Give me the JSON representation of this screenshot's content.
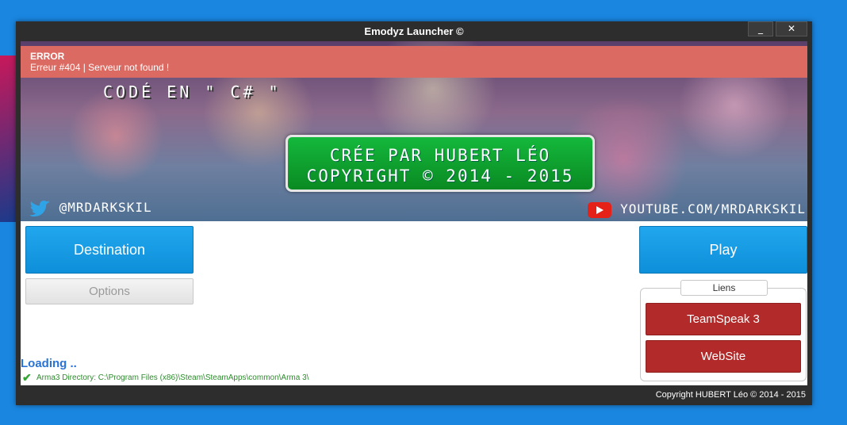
{
  "window": {
    "title": "Emodyz Launcher ©",
    "min_label": "_",
    "close_label": "✕"
  },
  "error": {
    "title": "ERROR",
    "message": "Erreur #404 | Serveur not found !"
  },
  "banner": {
    "line1": "CODÉ EN \" C# \"",
    "credit_line1": "CRÉE PAR HUBERT LÉO",
    "credit_line2": "COPYRIGHT © 2014 - 2015",
    "twitter": "@MRDARKSKIL",
    "youtube": "YOUTUBE.COM/MRDARKSKIL"
  },
  "buttons": {
    "destination": "Destination",
    "options": "Options",
    "play": "Play"
  },
  "liens": {
    "title": "Liens",
    "teamspeak": "TeamSpeak 3",
    "website": "WebSite"
  },
  "status": {
    "loading": "Loading ..",
    "directory": "Arma3 Directory: C:\\Program Files (x86)\\Steam\\SteamApps\\common\\Arma 3\\"
  },
  "footer": "Copyright HUBERT Léo © 2014 - 2015",
  "colors": {
    "error_bg": "#db6a62",
    "blue_button": "#1a9be6",
    "red_button": "#b22a2a",
    "desktop": "#1a86e0"
  }
}
